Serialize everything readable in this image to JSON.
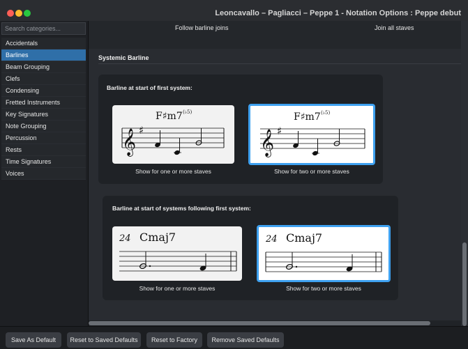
{
  "window": {
    "title": "Leoncavallo – Pagliacci – Peppe 1 - Notation Options : Peppe debut"
  },
  "sidebar": {
    "search_placeholder": "Search categories...",
    "items": [
      {
        "label": "Accidentals"
      },
      {
        "label": "Barlines",
        "selected": true
      },
      {
        "label": "Beam Grouping"
      },
      {
        "label": "Clefs"
      },
      {
        "label": "Condensing"
      },
      {
        "label": "Fretted Instruments"
      },
      {
        "label": "Key Signatures"
      },
      {
        "label": "Note Grouping"
      },
      {
        "label": "Percussion"
      },
      {
        "label": "Rests"
      },
      {
        "label": "Time Signatures"
      },
      {
        "label": "Voices"
      }
    ]
  },
  "main": {
    "top_options": [
      "Follow barline joins",
      "Join all staves"
    ],
    "section_title": "Systemic Barline",
    "group1": {
      "label": "Barline at start of first system:",
      "chord": "F♯m7",
      "chord_sup": "(♭5)",
      "options": [
        {
          "caption": "Show for one or more staves",
          "selected": false
        },
        {
          "caption": "Show for two or more staves",
          "selected": true
        }
      ]
    },
    "group2": {
      "label": "Barline at start of systems following first system:",
      "bar_number": "24",
      "chord": "Cmaj7",
      "options": [
        {
          "caption": "Show for one or more staves",
          "selected": false
        },
        {
          "caption": "Show for two or more staves",
          "selected": true
        }
      ]
    }
  },
  "footer": {
    "save_default": "Save As Default",
    "reset_saved": "Reset to Saved Defaults",
    "reset_factory": "Reset to Factory",
    "remove_saved": "Remove Saved Defaults"
  },
  "colors": {
    "accent": "#3ea1f0",
    "selection": "#2f6fa8"
  }
}
